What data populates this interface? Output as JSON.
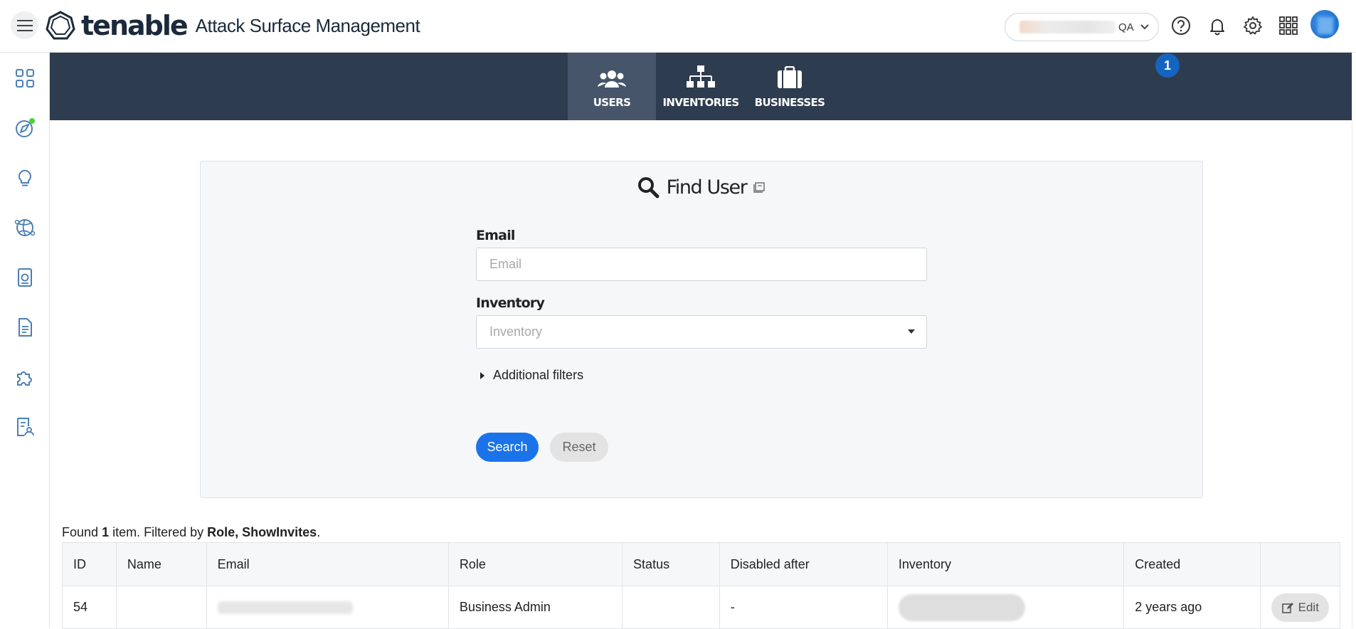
{
  "header": {
    "logo_brand": "tenable",
    "logo_product": "Attack Surface Management",
    "tenant_suffix": "QA",
    "icons": [
      "hamburger-icon",
      "help-icon",
      "bell-icon",
      "gear-icon",
      "apps-grid-icon"
    ]
  },
  "sidebar": {
    "items": [
      "dashboard-icon",
      "discover-icon",
      "insights-icon",
      "globe-icon",
      "report-icon",
      "document-icon",
      "integrations-icon",
      "user-report-icon"
    ]
  },
  "nav": {
    "tabs": [
      {
        "label": "USERS",
        "active": true,
        "icon": "users-icon"
      },
      {
        "label": "INVENTORIES",
        "active": false,
        "icon": "hierarchy-icon"
      },
      {
        "label": "BUSINESSES",
        "active": false,
        "icon": "briefcase-icon"
      }
    ],
    "badge": "1"
  },
  "find_user": {
    "title": "Find User",
    "email_label": "Email",
    "email_placeholder": "Email",
    "inventory_label": "Inventory",
    "inventory_placeholder": "Inventory",
    "additional_filters": "Additional filters",
    "search_label": "Search",
    "reset_label": "Reset"
  },
  "results": {
    "found_prefix": "Found",
    "found_count": "1",
    "found_mid": "item. Filtered by",
    "filters": "Role, ShowInvites",
    "found_suffix": ".",
    "columns": [
      "ID",
      "Name",
      "Email",
      "Role",
      "Status",
      "Disabled after",
      "Inventory",
      "Created",
      ""
    ],
    "rows": [
      {
        "id": "54",
        "name": "",
        "role": "Business Admin",
        "status": "",
        "disabled_after": "-",
        "created": "2 years ago",
        "edit_label": "Edit"
      }
    ]
  },
  "colors": {
    "nav_band": "#2e3c4f",
    "nav_active": "#46556a",
    "primary": "#1a73e8",
    "badge": "#1565c0"
  }
}
